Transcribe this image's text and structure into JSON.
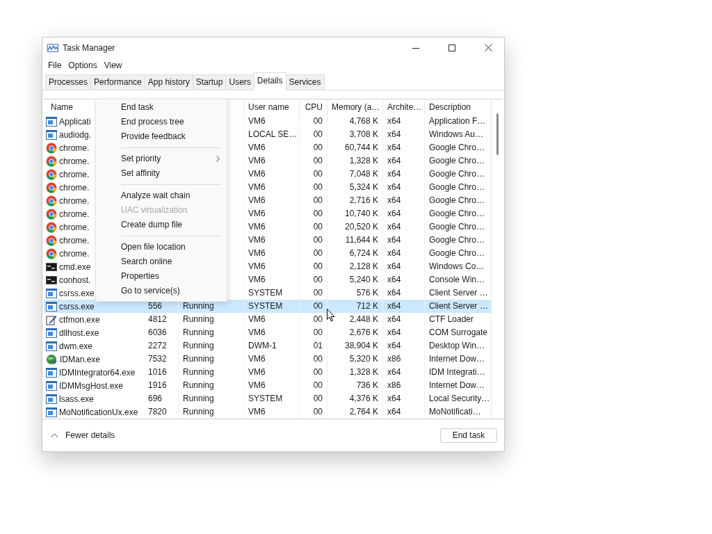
{
  "window": {
    "title": "Task Manager"
  },
  "menu_bar": [
    "File",
    "Options",
    "View"
  ],
  "tabs": [
    {
      "label": "Processes",
      "selected": false
    },
    {
      "label": "Performance",
      "selected": false
    },
    {
      "label": "App history",
      "selected": false
    },
    {
      "label": "Startup",
      "selected": false
    },
    {
      "label": "Users",
      "selected": false
    },
    {
      "label": "Details",
      "selected": true
    },
    {
      "label": "Services",
      "selected": false
    }
  ],
  "table": {
    "columns": {
      "name": "Name",
      "user_name": "User name",
      "cpu": "CPU",
      "memory": "Memory (a…",
      "architecture": "Archite…",
      "description": "Description"
    },
    "rows": [
      {
        "kind": "app",
        "name": "Applicati",
        "user_name": "VM6",
        "cpu": "00",
        "memory": "4,768 K",
        "architecture": "x64",
        "description": "Application F…",
        "selected": false
      },
      {
        "kind": "app",
        "name": "audiodg.",
        "user_name": "LOCAL SE…",
        "cpu": "00",
        "memory": "3,708 K",
        "architecture": "x64",
        "description": "Windows Au…",
        "selected": false
      },
      {
        "kind": "chrome",
        "name": "chrome.",
        "user_name": "VM6",
        "cpu": "00",
        "memory": "60,744 K",
        "architecture": "x64",
        "description": "Google Chro…",
        "selected": false
      },
      {
        "kind": "chrome",
        "name": "chrome.",
        "user_name": "VM6",
        "cpu": "00",
        "memory": "1,328 K",
        "architecture": "x64",
        "description": "Google Chro…",
        "selected": false
      },
      {
        "kind": "chrome",
        "name": "chrome.",
        "user_name": "VM6",
        "cpu": "00",
        "memory": "7,048 K",
        "architecture": "x64",
        "description": "Google Chro…",
        "selected": false
      },
      {
        "kind": "chrome",
        "name": "chrome.",
        "user_name": "VM6",
        "cpu": "00",
        "memory": "5,324 K",
        "architecture": "x64",
        "description": "Google Chro…",
        "selected": false
      },
      {
        "kind": "chrome",
        "name": "chrome.",
        "user_name": "VM6",
        "cpu": "00",
        "memory": "2,716 K",
        "architecture": "x64",
        "description": "Google Chro…",
        "selected": false
      },
      {
        "kind": "chrome",
        "name": "chrome.",
        "user_name": "VM6",
        "cpu": "00",
        "memory": "10,740 K",
        "architecture": "x64",
        "description": "Google Chro…",
        "selected": false
      },
      {
        "kind": "chrome",
        "name": "chrome.",
        "user_name": "VM6",
        "cpu": "00",
        "memory": "20,520 K",
        "architecture": "x64",
        "description": "Google Chro…",
        "selected": false
      },
      {
        "kind": "chrome",
        "name": "chrome.",
        "user_name": "VM6",
        "cpu": "00",
        "memory": "11,644 K",
        "architecture": "x64",
        "description": "Google Chro…",
        "selected": false
      },
      {
        "kind": "chrome",
        "name": "chrome.",
        "user_name": "VM6",
        "cpu": "00",
        "memory": "6,724 K",
        "architecture": "x64",
        "description": "Google Chro…",
        "selected": false
      },
      {
        "kind": "console",
        "name": "cmd.exe",
        "user_name": "VM6",
        "cpu": "00",
        "memory": "2,128 K",
        "architecture": "x64",
        "description": "Windows Co…",
        "selected": false
      },
      {
        "kind": "console",
        "name": "conhost.",
        "user_name": "VM6",
        "cpu": "00",
        "memory": "5,240 K",
        "architecture": "x64",
        "description": "Console Win…",
        "selected": false
      },
      {
        "kind": "app",
        "name": "csrss.exe",
        "user_name": "SYSTEM",
        "cpu": "00",
        "memory": "576 K",
        "architecture": "x64",
        "description": "Client Server …",
        "selected": false
      },
      {
        "kind": "app",
        "name": "csrss.exe",
        "pid": "556",
        "status": "Running",
        "user_name": "SYSTEM",
        "cpu": "00",
        "memory": "712 K",
        "architecture": "x64",
        "description": "Client Server …",
        "selected": true
      },
      {
        "kind": "pen",
        "name": "ctfmon.exe",
        "pid": "4812",
        "status": "Running",
        "user_name": "VM6",
        "cpu": "00",
        "memory": "2,448 K",
        "architecture": "x64",
        "description": "CTF Loader",
        "selected": false
      },
      {
        "kind": "app",
        "name": "dllhost.exe",
        "pid": "6036",
        "status": "Running",
        "user_name": "VM6",
        "cpu": "00",
        "memory": "2,676 K",
        "architecture": "x64",
        "description": "COM Surrogate",
        "selected": false
      },
      {
        "kind": "app",
        "name": "dwm.exe",
        "pid": "2272",
        "status": "Running",
        "user_name": "DWM-1",
        "cpu": "01",
        "memory": "38,904 K",
        "architecture": "x64",
        "description": "Desktop Win…",
        "selected": false
      },
      {
        "kind": "globe",
        "name": "IDMan.exe",
        "pid": "7532",
        "status": "Running",
        "user_name": "VM6",
        "cpu": "00",
        "memory": "5,320 K",
        "architecture": "x86",
        "description": "Internet Dow…",
        "selected": false
      },
      {
        "kind": "app",
        "name": "IDMIntegrator64.exe",
        "pid": "1016",
        "status": "Running",
        "user_name": "VM6",
        "cpu": "00",
        "memory": "1,328 K",
        "architecture": "x64",
        "description": "IDM Integrati…",
        "selected": false
      },
      {
        "kind": "app",
        "name": "IDMMsgHost.exe",
        "pid": "1916",
        "status": "Running",
        "user_name": "VM6",
        "cpu": "00",
        "memory": "736 K",
        "architecture": "x86",
        "description": "Internet Dow…",
        "selected": false
      },
      {
        "kind": "app",
        "name": "lsass.exe",
        "pid": "696",
        "status": "Running",
        "user_name": "SYSTEM",
        "cpu": "00",
        "memory": "4,376 K",
        "architecture": "x64",
        "description": "Local Security…",
        "selected": false
      },
      {
        "kind": "app",
        "name": "MoNotificationUx.exe",
        "pid": "7820",
        "status": "Running",
        "user_name": "VM6",
        "cpu": "00",
        "memory": "2,764 K",
        "architecture": "x64",
        "description": "MoNotificati…",
        "selected": false
      }
    ]
  },
  "context_menu": [
    {
      "kind": "item",
      "label": "End task",
      "disabled": false
    },
    {
      "kind": "item",
      "label": "End process tree",
      "disabled": false
    },
    {
      "kind": "item",
      "label": "Provide feedback",
      "disabled": false
    },
    {
      "kind": "separator"
    },
    {
      "kind": "submenu",
      "label": "Set priority",
      "disabled": false
    },
    {
      "kind": "item",
      "label": "Set affinity",
      "disabled": false
    },
    {
      "kind": "separator"
    },
    {
      "kind": "item",
      "label": "Analyze wait chain",
      "disabled": false
    },
    {
      "kind": "item",
      "label": "UAC virtualization",
      "disabled": true
    },
    {
      "kind": "item",
      "label": "Create dump file",
      "disabled": false
    },
    {
      "kind": "separator"
    },
    {
      "kind": "item",
      "label": "Open file location",
      "disabled": false
    },
    {
      "kind": "item",
      "label": "Search online",
      "disabled": false
    },
    {
      "kind": "item",
      "label": "Properties",
      "disabled": false
    },
    {
      "kind": "item",
      "label": "Go to service(s)",
      "disabled": false
    }
  ],
  "footer": {
    "toggle": "Fewer details",
    "button": "End task"
  }
}
